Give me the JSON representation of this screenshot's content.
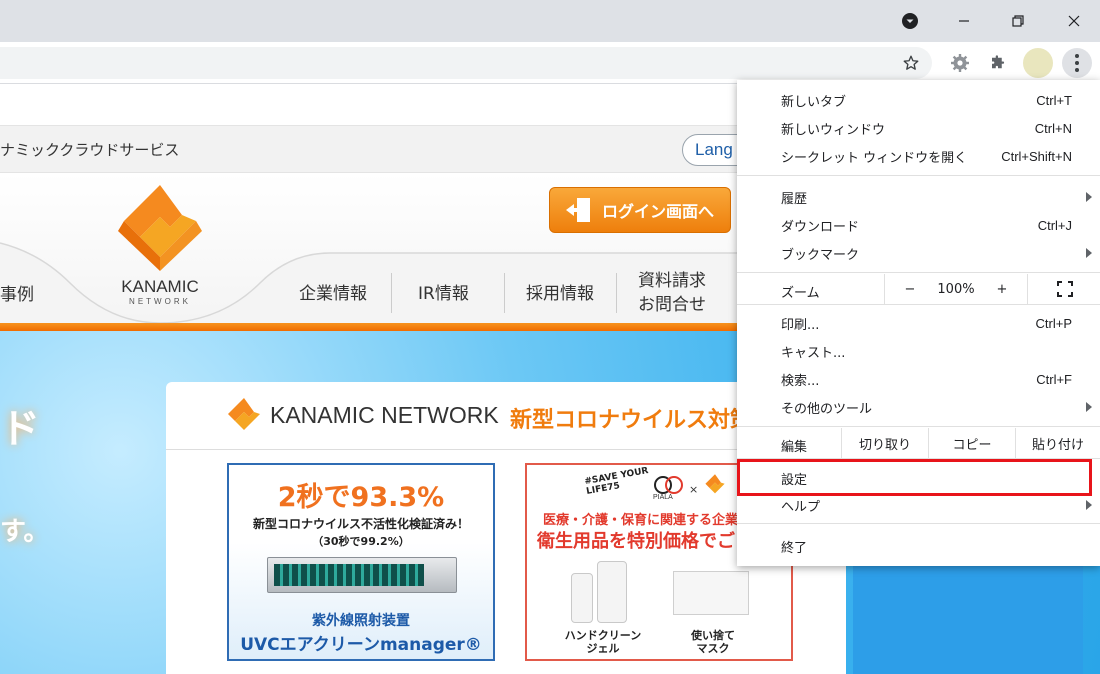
{
  "page": {
    "announce_text": "ナミッククラウドサービス",
    "lang_button": "Lang",
    "login_button": "ログイン画面へ",
    "logo": {
      "name": "KANAMIC",
      "sub": "NETWORK"
    },
    "nav_left_fragment": "事例",
    "nav": [
      {
        "label": "企業情報"
      },
      {
        "label": "IR情報"
      },
      {
        "label": "採用情報"
      },
      {
        "label_line1": "資料請求",
        "label_line2": "お問合せ"
      }
    ],
    "hero_text_1": "ド",
    "hero_text_2": "す。",
    "panel": {
      "brand": "KANAMIC NETWORK",
      "title": "新型コロナウイルス対策"
    },
    "banner_uvc": {
      "headline": "2秒で93.3%",
      "sub1": "新型コロナウイルス不活性化検証済み！",
      "sub2": "（30秒で99.2%）",
      "label1": "紫外線照射装置",
      "label2": "UVCエアクリーンmanager®"
    },
    "banner_hygiene": {
      "tag": "#SAVE YOUR LIFE75",
      "partner": "PIALA",
      "x_mark": "×",
      "line1": "医療・介護・保育に関連する企業",
      "line2": "衛生用品を特別価格でご",
      "caption_left_1": "ハンドクリーン",
      "caption_left_2": "ジェル",
      "caption_right_1": "使い捨て",
      "caption_right_2": "マスク"
    }
  },
  "menu": {
    "items": [
      {
        "label": "新しいタブ",
        "shortcut": "Ctrl+T"
      },
      {
        "label": "新しいウィンドウ",
        "shortcut": "Ctrl+N"
      },
      {
        "label": "シークレット ウィンドウを開く",
        "shortcut": "Ctrl+Shift+N"
      },
      {
        "label": "履歴",
        "shortcut": ""
      },
      {
        "label": "ダウンロード",
        "shortcut": "Ctrl+J"
      },
      {
        "label": "ブックマーク",
        "shortcut": ""
      },
      {
        "label": "印刷...",
        "shortcut": "Ctrl+P"
      },
      {
        "label": "キャスト...",
        "shortcut": ""
      },
      {
        "label": "検索...",
        "shortcut": "Ctrl+F"
      },
      {
        "label": "その他のツール",
        "shortcut": ""
      },
      {
        "label": "設定",
        "shortcut": ""
      },
      {
        "label": "ヘルプ",
        "shortcut": ""
      },
      {
        "label": "終了",
        "shortcut": ""
      }
    ],
    "zoom": {
      "label": "ズーム",
      "minus": "−",
      "value": "100%",
      "plus": "+"
    },
    "edit": {
      "label": "編集",
      "cut": "切り取り",
      "copy": "コピー",
      "paste": "貼り付け"
    }
  },
  "colors": {
    "highlight": "#e8141a",
    "brand_orange": "#f07c0e",
    "chrome_frame": "#dee1e6"
  }
}
